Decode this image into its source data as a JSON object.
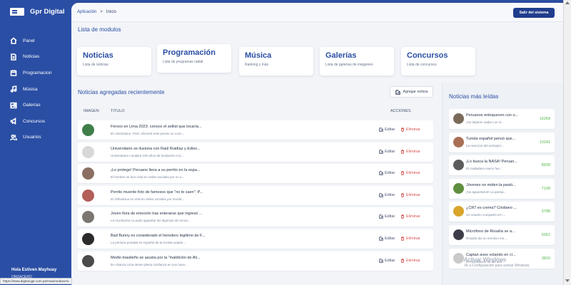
{
  "brand": {
    "name": "Gpr Digital"
  },
  "sidebar": {
    "items": [
      {
        "label": "Panel",
        "icon": "home-icon"
      },
      {
        "label": "Noticias",
        "icon": "document-icon"
      },
      {
        "label": "Programacion",
        "icon": "calendar-icon"
      },
      {
        "label": "Música",
        "icon": "music-icon"
      },
      {
        "label": "Galerías",
        "icon": "image-icon"
      },
      {
        "label": "Concursos",
        "icon": "megaphone-icon"
      },
      {
        "label": "Usuarios",
        "icon": "users-icon"
      }
    ],
    "user_name": "Hola Estiven Mayhuay",
    "user_role": "ONDACERO"
  },
  "breadcrumb": {
    "root": "Aplicación",
    "separator": ">",
    "current": "Inicio"
  },
  "header": {
    "logout_label": "Salir del sistema"
  },
  "modules": {
    "title": "Lista de modulos",
    "items": [
      {
        "title": "Noticias",
        "subtitle": "Lista de noticias"
      },
      {
        "title": "Programación",
        "subtitle": "Lista de programas radial"
      },
      {
        "title": "Música",
        "subtitle": "Ranking y más"
      },
      {
        "title": "Galerías",
        "subtitle": "Lista de galerías de imágenes"
      },
      {
        "title": "Concursos",
        "subtitle": "Lista de concursos"
      }
    ]
  },
  "recent": {
    "title": "Noticias agregadas recientemente",
    "add_label": "Agregar noticia",
    "columns": {
      "image": "IMAGEN",
      "title": "TITULO",
      "actions": "ACCIONES"
    },
    "edit_label": "Editar",
    "delete_label": "Eliminar",
    "rows": [
      {
        "title": "Ferxxo en Lima 2023: conoce el setlist que tocaría...",
        "summary": "El colombiano, Feid, ofrecerá este jueves un conc...",
        "color": "#3f7d4a"
      },
      {
        "title": "Universitario se ilusiona con Raúl Ruidíaz y Ediso...",
        "summary": "Universitario cumplirá 100 años de fundación el p...",
        "color": "#d8d8d8"
      },
      {
        "title": "¡Lo protege! Peruano lleva a su perrito en la espa...",
        "summary": "El hombre se hizo viral en redes sociales por no a...",
        "color": "#8a6f62"
      },
      {
        "title": "Perrito muerde foto de famosos que \"no le caen\": P...",
        "summary": "El chihuahua es viral en redes sociales por morde...",
        "color": "#b45e58"
      },
      {
        "title": "Joven llora de emoción tras enterarse que ingresó ...",
        "summary": "La muchacha no pudo aguantar las lágrimas de emoci...",
        "color": "#7b7770"
      },
      {
        "title": "Bad Bunny es considerado el heredero legítimo de F...",
        "summary": "La primera portada en español de la revista asiado...",
        "color": "#2b2b2b"
      },
      {
        "title": "Medio brasileño se asusta por la \"maldición de Ali...",
        "summary": "En Alianza Lima tienen plena confianza en sus nuev...",
        "color": "#4b4b4b"
      }
    ]
  },
  "most_read": {
    "title": "Noticias más leídas",
    "rows": [
      {
        "title": "Peruanos enloquecen con o...",
        "summary": "¡No dejaron nada! Los cl...",
        "count": "16269",
        "color": "#7b6a5c"
      },
      {
        "title": "Turista español pensó que...",
        "summary": "La reacción del extranjer...",
        "count": "10241",
        "color": "#a86f55"
      },
      {
        "title": "¡Lo busca la NASA! Peruan...",
        "summary": "El ciudadano sueco fue...",
        "count": "8928",
        "color": "#5b5b5b"
      },
      {
        "title": "Jóvenes no miden la pasió...",
        "summary": "¡No aguantaron! La pareja...",
        "count": "7108",
        "color": "#5f8f3f"
      },
      {
        "title": "¿CR7 es crema? Cristiano ...",
        "summary": "Un usuario compartió en r...",
        "count": "5788",
        "color": "#d9a52b"
      },
      {
        "title": "Micrófono de Rosalía se a...",
        "summary": "Rosalía dio un emotivo me...",
        "count": "5061",
        "color": "#3c3c4a"
      },
      {
        "title": "Captan aves volando en cí...",
        "summary": "El movimiento de las ave...",
        "count": "3810",
        "color": "#c9c9c9"
      }
    ]
  },
  "watermark": {
    "title": "Activar Windows",
    "subtitle": "Ve a Configuración para activar Windows."
  },
  "statusbar": {
    "url": "https://www.digital-gpr.com.pe/main/ondacero"
  }
}
